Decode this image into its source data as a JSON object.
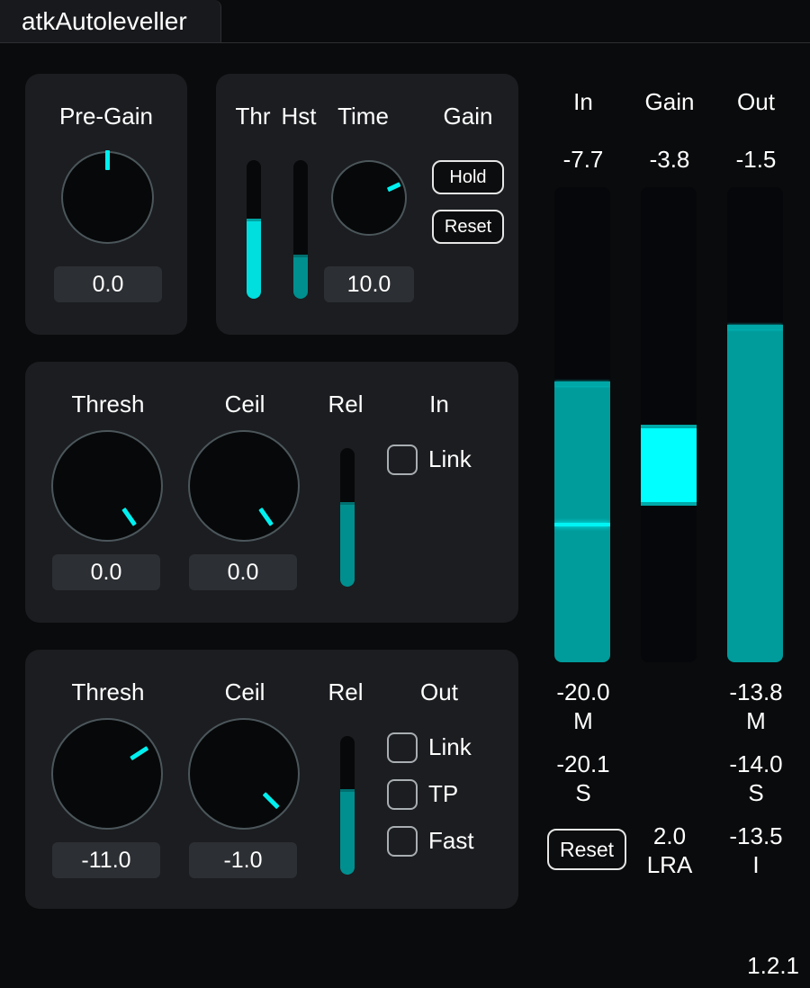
{
  "window": {
    "title": "atkAutoleveller"
  },
  "pregain": {
    "label": "Pre-Gain",
    "value": "0.0",
    "knob_angle_deg": 0
  },
  "gain_section": {
    "thr_label": "Thr",
    "hst_label": "Hst",
    "time_label": "Time",
    "gain_label": "Gain",
    "thr_fill": 0.58,
    "hst_fill": 0.32,
    "time_value": "10.0",
    "time_knob_angle_deg": 65,
    "hold_button": "Hold",
    "reset_button": "Reset"
  },
  "in_section": {
    "thresh_label": "Thresh",
    "ceil_label": "Ceil",
    "rel_label": "Rel",
    "header": "In",
    "thresh_value": "0.0",
    "ceil_value": "0.0",
    "thresh_knob_angle_deg": 145,
    "ceil_knob_angle_deg": 145,
    "rel_fill": 0.61,
    "link_label": "Link",
    "link_checked": false
  },
  "out_section": {
    "thresh_label": "Thresh",
    "ceil_label": "Ceil",
    "rel_label": "Rel",
    "header": "Out",
    "thresh_value": "-11.0",
    "ceil_value": "-1.0",
    "thresh_knob_angle_deg": 57,
    "ceil_knob_angle_deg": 135,
    "rel_fill": 0.62,
    "link_label": "Link",
    "tp_label": "TP",
    "fast_label": "Fast",
    "link_checked": false,
    "tp_checked": false,
    "fast_checked": false
  },
  "meters": {
    "in": {
      "label": "In",
      "peak": "-7.7",
      "level": 0.59,
      "line": 0.29
    },
    "gain": {
      "label": "Gain",
      "peak": "-3.8",
      "bar_top": 0.5,
      "bar_bottom": 0.33
    },
    "out": {
      "label": "Out",
      "peak": "-1.5",
      "level": 0.71
    }
  },
  "loudness": {
    "in_m_value": "-20.0",
    "in_m_label": "M",
    "in_s_value": "-20.1",
    "in_s_label": "S",
    "out_m_value": "-13.8",
    "out_m_label": "M",
    "out_s_value": "-14.0",
    "out_s_label": "S",
    "out_i_value": "-13.5",
    "out_i_label": "I",
    "lra_value": "2.0",
    "lra_label": "LRA",
    "reset_button": "Reset"
  },
  "version": "1.2.1",
  "colors": {
    "accent": "#00f0f0",
    "fill": "#009b9b",
    "bright": "#00ffff",
    "panel": "#1b1d20"
  }
}
